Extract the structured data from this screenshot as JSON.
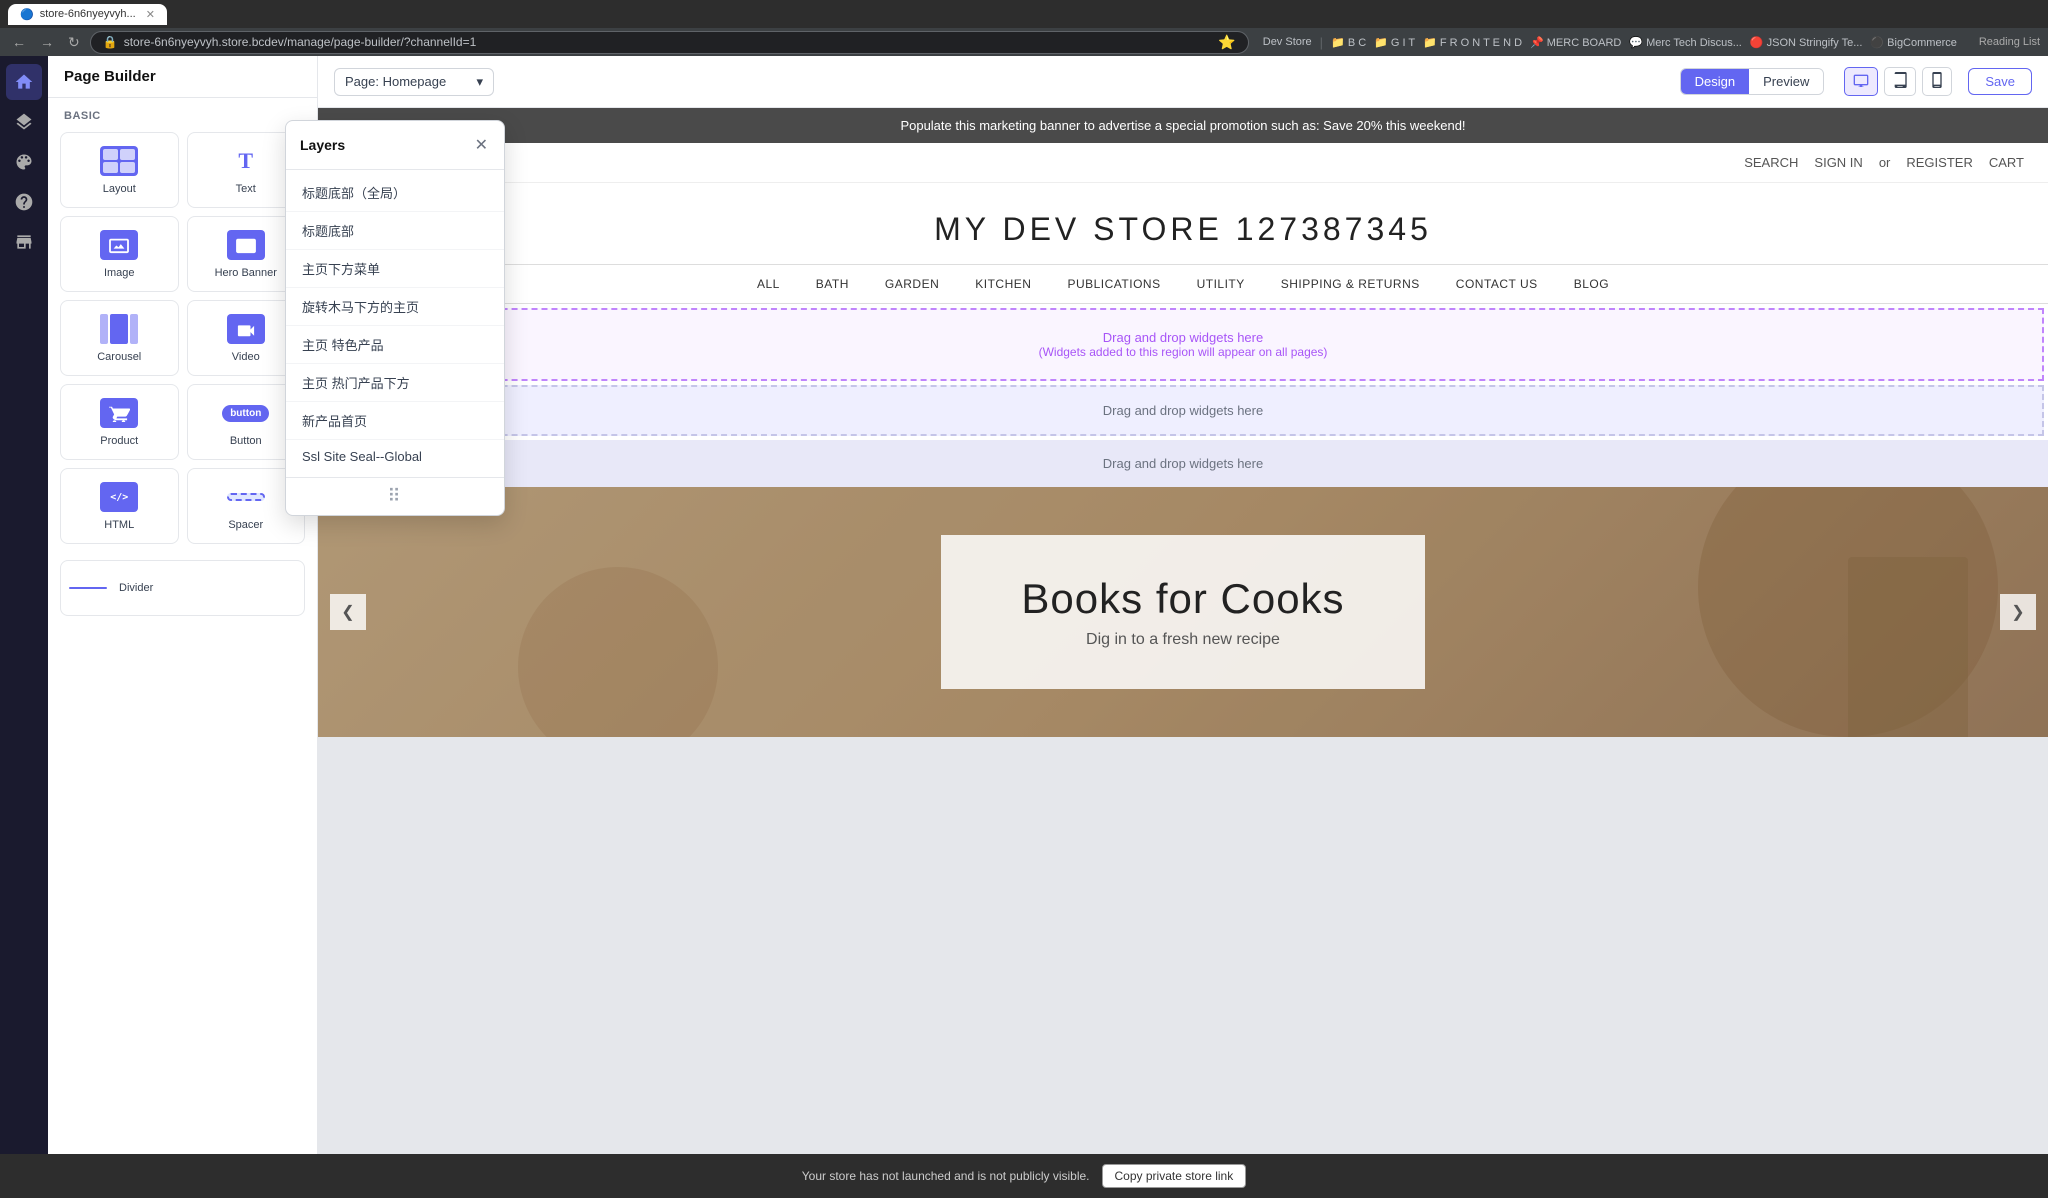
{
  "browser": {
    "url": "store-6n6nyeyvyh.store.bcdev/manage/page-builder/?channelId=1",
    "tabs": [
      {
        "label": "Dev Store"
      },
      {
        "label": "B C"
      },
      {
        "label": "G I T"
      },
      {
        "label": "F R O N T E N D"
      },
      {
        "label": "MERC BOARD"
      },
      {
        "label": "Merc Tech Discus..."
      },
      {
        "label": "JSON Stringify Te..."
      },
      {
        "label": "BigCommerce"
      }
    ]
  },
  "topbar": {
    "page_selector_label": "Page: Homepage",
    "design_btn": "Design",
    "preview_btn": "Preview",
    "save_btn": "Save"
  },
  "sidebar": {
    "title": "Page Builder",
    "section_basic": "BASIC",
    "widgets": [
      {
        "id": "layout",
        "label": "Layout"
      },
      {
        "id": "text",
        "label": "Text"
      },
      {
        "id": "image",
        "label": "Image"
      },
      {
        "id": "hero-banner",
        "label": "Hero Banner"
      },
      {
        "id": "carousel",
        "label": "Carousel"
      },
      {
        "id": "video",
        "label": "Video"
      },
      {
        "id": "product",
        "label": "Product"
      },
      {
        "id": "button",
        "label": "Button"
      },
      {
        "id": "html",
        "label": "HTML"
      },
      {
        "id": "spacer",
        "label": "Spacer"
      },
      {
        "id": "divider",
        "label": "Divider"
      }
    ]
  },
  "layers": {
    "title": "Layers",
    "items": [
      {
        "label": "标题底部（全局）"
      },
      {
        "label": "标题底部"
      },
      {
        "label": "主页下方菜单"
      },
      {
        "label": "旋转木马下方的主页"
      },
      {
        "label": "主页 特色产品"
      },
      {
        "label": "主页 热门产品下方"
      },
      {
        "label": "新产品首页"
      },
      {
        "label": "Ssl Site Seal--Global"
      }
    ]
  },
  "store_preview": {
    "marketing_banner": "Populate this marketing banner to advertise a special promotion such as: Save 20% this weekend!",
    "nav_search": "SEARCH",
    "nav_signin": "SIGN IN",
    "nav_or": "or",
    "nav_register": "REGISTER",
    "nav_cart": "CART",
    "store_title": "MY DEV STORE 127387345",
    "main_nav": [
      {
        "label": "ALL"
      },
      {
        "label": "BATH"
      },
      {
        "label": "GARDEN"
      },
      {
        "label": "KITCHEN"
      },
      {
        "label": "PUBLICATIONS"
      },
      {
        "label": "UTILITY"
      },
      {
        "label": "SHIPPING & RETURNS"
      },
      {
        "label": "CONTACT US"
      },
      {
        "label": "BLOG"
      }
    ],
    "dropzone_global_text": "Drag and drop widgets here",
    "dropzone_global_subtext": "(Widgets added to this region will appear on all pages)",
    "dropzone_plain_text": "Drag and drop widgets here",
    "dropzone_blue_text": "Drag and drop widgets here",
    "hero_title": "Books for Cooks",
    "hero_subtitle": "Dig in to a fresh new recipe"
  },
  "status_bar": {
    "message": "Your store has not launched and is not publicly visible.",
    "copy_btn": "Copy private store link"
  }
}
